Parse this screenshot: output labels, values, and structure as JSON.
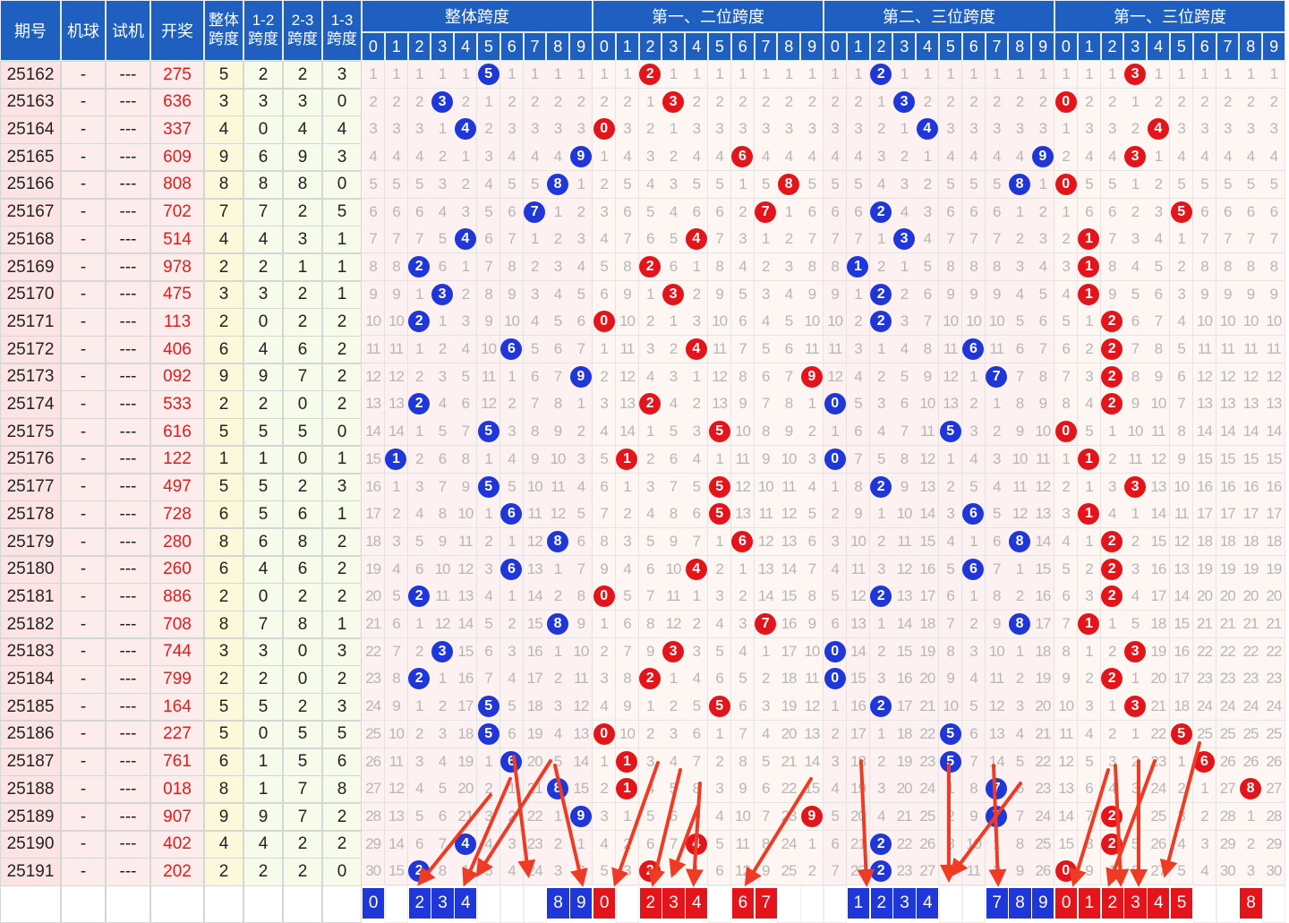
{
  "header": {
    "col_issue": "期号",
    "col_machine": "机球",
    "col_trial": "试机",
    "col_draw": "开奖",
    "col_overall": [
      "整体",
      "跨度"
    ],
    "col_12": [
      "1-2",
      "跨度"
    ],
    "col_23": [
      "2-3",
      "跨度"
    ],
    "col_13": [
      "1-3",
      "跨度"
    ],
    "groups": [
      "整体跨度",
      "第一、二位跨度",
      "第二、三位跨度",
      "第一、三位跨度"
    ],
    "digits": [
      "0",
      "1",
      "2",
      "3",
      "4",
      "5",
      "6",
      "7",
      "8",
      "9"
    ]
  },
  "colors": {
    "header_bg": "#1e5fbf",
    "blue_ball": "#1f36d8",
    "red_ball": "#e4141b",
    "draw_text": "#e11c1c",
    "arrow": "#ef3b24"
  },
  "rows": [
    {
      "issue": "25162",
      "machine": "-",
      "trial": "---",
      "draw": "275",
      "overall": "5",
      "s12": "2",
      "s23": "2",
      "s13": "3"
    },
    {
      "issue": "25163",
      "machine": "-",
      "trial": "---",
      "draw": "636",
      "overall": "3",
      "s12": "3",
      "s23": "3",
      "s13": "0"
    },
    {
      "issue": "25164",
      "machine": "-",
      "trial": "---",
      "draw": "337",
      "overall": "4",
      "s12": "0",
      "s23": "4",
      "s13": "4"
    },
    {
      "issue": "25165",
      "machine": "-",
      "trial": "---",
      "draw": "609",
      "overall": "9",
      "s12": "6",
      "s23": "9",
      "s13": "3"
    },
    {
      "issue": "25166",
      "machine": "-",
      "trial": "---",
      "draw": "808",
      "overall": "8",
      "s12": "8",
      "s23": "8",
      "s13": "0"
    },
    {
      "issue": "25167",
      "machine": "-",
      "trial": "---",
      "draw": "702",
      "overall": "7",
      "s12": "7",
      "s23": "2",
      "s13": "5"
    },
    {
      "issue": "25168",
      "machine": "-",
      "trial": "---",
      "draw": "514",
      "overall": "4",
      "s12": "4",
      "s23": "3",
      "s13": "1"
    },
    {
      "issue": "25169",
      "machine": "-",
      "trial": "---",
      "draw": "978",
      "overall": "2",
      "s12": "2",
      "s23": "1",
      "s13": "1"
    },
    {
      "issue": "25170",
      "machine": "-",
      "trial": "---",
      "draw": "475",
      "overall": "3",
      "s12": "3",
      "s23": "2",
      "s13": "1"
    },
    {
      "issue": "25171",
      "machine": "-",
      "trial": "---",
      "draw": "113",
      "overall": "2",
      "s12": "0",
      "s23": "2",
      "s13": "2"
    },
    {
      "issue": "25172",
      "machine": "-",
      "trial": "---",
      "draw": "406",
      "overall": "6",
      "s12": "4",
      "s23": "6",
      "s13": "2"
    },
    {
      "issue": "25173",
      "machine": "-",
      "trial": "---",
      "draw": "092",
      "overall": "9",
      "s12": "9",
      "s23": "7",
      "s13": "2"
    },
    {
      "issue": "25174",
      "machine": "-",
      "trial": "---",
      "draw": "533",
      "overall": "2",
      "s12": "2",
      "s23": "0",
      "s13": "2"
    },
    {
      "issue": "25175",
      "machine": "-",
      "trial": "---",
      "draw": "616",
      "overall": "5",
      "s12": "5",
      "s23": "5",
      "s13": "0"
    },
    {
      "issue": "25176",
      "machine": "-",
      "trial": "---",
      "draw": "122",
      "overall": "1",
      "s12": "1",
      "s23": "0",
      "s13": "1"
    },
    {
      "issue": "25177",
      "machine": "-",
      "trial": "---",
      "draw": "497",
      "overall": "5",
      "s12": "5",
      "s23": "2",
      "s13": "3"
    },
    {
      "issue": "25178",
      "machine": "-",
      "trial": "---",
      "draw": "728",
      "overall": "6",
      "s12": "5",
      "s23": "6",
      "s13": "1"
    },
    {
      "issue": "25179",
      "machine": "-",
      "trial": "---",
      "draw": "280",
      "overall": "8",
      "s12": "6",
      "s23": "8",
      "s13": "2"
    },
    {
      "issue": "25180",
      "machine": "-",
      "trial": "---",
      "draw": "260",
      "overall": "6",
      "s12": "4",
      "s23": "6",
      "s13": "2"
    },
    {
      "issue": "25181",
      "machine": "-",
      "trial": "---",
      "draw": "886",
      "overall": "2",
      "s12": "0",
      "s23": "2",
      "s13": "2"
    },
    {
      "issue": "25182",
      "machine": "-",
      "trial": "---",
      "draw": "708",
      "overall": "8",
      "s12": "7",
      "s23": "8",
      "s13": "1"
    },
    {
      "issue": "25183",
      "machine": "-",
      "trial": "---",
      "draw": "744",
      "overall": "3",
      "s12": "3",
      "s23": "0",
      "s13": "3"
    },
    {
      "issue": "25184",
      "machine": "-",
      "trial": "---",
      "draw": "799",
      "overall": "2",
      "s12": "2",
      "s23": "0",
      "s13": "2"
    },
    {
      "issue": "25185",
      "machine": "-",
      "trial": "---",
      "draw": "164",
      "overall": "5",
      "s12": "5",
      "s23": "2",
      "s13": "3"
    },
    {
      "issue": "25186",
      "machine": "-",
      "trial": "---",
      "draw": "227",
      "overall": "5",
      "s12": "0",
      "s23": "5",
      "s13": "5"
    },
    {
      "issue": "25187",
      "machine": "-",
      "trial": "---",
      "draw": "761",
      "overall": "6",
      "s12": "1",
      "s23": "5",
      "s13": "6"
    },
    {
      "issue": "25188",
      "machine": "-",
      "trial": "---",
      "draw": "018",
      "overall": "8",
      "s12": "1",
      "s23": "7",
      "s13": "8"
    },
    {
      "issue": "25189",
      "machine": "-",
      "trial": "---",
      "draw": "907",
      "overall": "9",
      "s12": "9",
      "s23": "7",
      "s13": "2"
    },
    {
      "issue": "25190",
      "machine": "-",
      "trial": "---",
      "draw": "402",
      "overall": "4",
      "s12": "4",
      "s23": "2",
      "s13": "2"
    },
    {
      "issue": "25191",
      "machine": "-",
      "trial": "---",
      "draw": "202",
      "overall": "2",
      "s12": "2",
      "s23": "2",
      "s13": "0"
    }
  ],
  "footer_picks": [
    [
      "0",
      "2",
      "3",
      "4",
      "8",
      "9"
    ],
    [
      "0",
      "2",
      "3",
      "4",
      "6",
      "7"
    ],
    [
      "1",
      "2",
      "3",
      "4",
      "7",
      "8",
      "9"
    ],
    [
      "0",
      "1",
      "2",
      "3",
      "4",
      "5",
      "8"
    ]
  ]
}
